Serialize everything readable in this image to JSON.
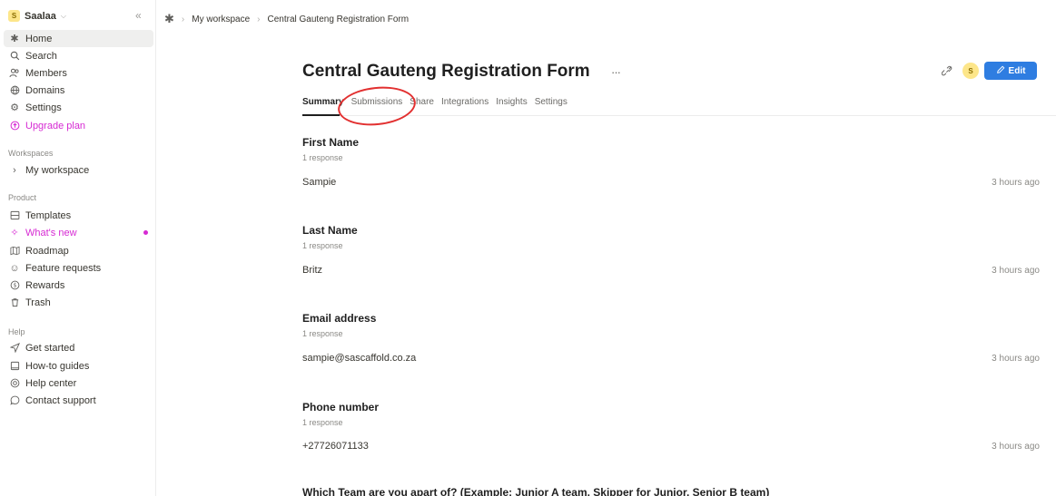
{
  "workspace": {
    "avatar": "S",
    "name": "Saalaa"
  },
  "sidebar": {
    "main": [
      {
        "label": "Home",
        "icon": "star-icon"
      },
      {
        "label": "Search",
        "icon": "search-icon"
      },
      {
        "label": "Members",
        "icon": "members-icon"
      },
      {
        "label": "Domains",
        "icon": "globe-icon"
      },
      {
        "label": "Settings",
        "icon": "gear-icon"
      },
      {
        "label": "Upgrade plan",
        "icon": "upgrade-icon"
      }
    ],
    "workspaces_heading": "Workspaces",
    "workspaces": [
      {
        "label": "My workspace"
      }
    ],
    "product_heading": "Product",
    "product": [
      {
        "label": "Templates"
      },
      {
        "label": "What's new"
      },
      {
        "label": "Roadmap"
      },
      {
        "label": "Feature requests"
      },
      {
        "label": "Rewards"
      },
      {
        "label": "Trash"
      }
    ],
    "help_heading": "Help",
    "help": [
      {
        "label": "Get started"
      },
      {
        "label": "How-to guides"
      },
      {
        "label": "Help center"
      },
      {
        "label": "Contact support"
      }
    ]
  },
  "breadcrumb": {
    "items": [
      "My workspace",
      "Central Gauteng Registration Form"
    ]
  },
  "form": {
    "title": "Central Gauteng Registration Form",
    "tabs": [
      "Summary",
      "Submissions",
      "Share",
      "Integrations",
      "Insights",
      "Settings"
    ],
    "user_avatar": "S",
    "edit_label": "Edit",
    "questions": [
      {
        "title": "First Name",
        "count": "1 response",
        "answer": "Sampie",
        "time": "3 hours ago"
      },
      {
        "title": "Last Name",
        "count": "1 response",
        "answer": "Britz",
        "time": "3 hours ago"
      },
      {
        "title": "Email address",
        "count": "1 response",
        "answer": "sampie@sascaffold.co.za",
        "time": "3 hours ago"
      },
      {
        "title": "Phone number",
        "count": "1 response",
        "answer": "+27726071133",
        "time": "3 hours ago"
      }
    ],
    "cutoff_question": "Which Team are you apart of? (Example: Junior A team, Skipper for Junior, Senior B team)"
  },
  "colors": {
    "accent": "#2e7de1",
    "pink": "#d62ad3",
    "annotation": "#e23030"
  }
}
